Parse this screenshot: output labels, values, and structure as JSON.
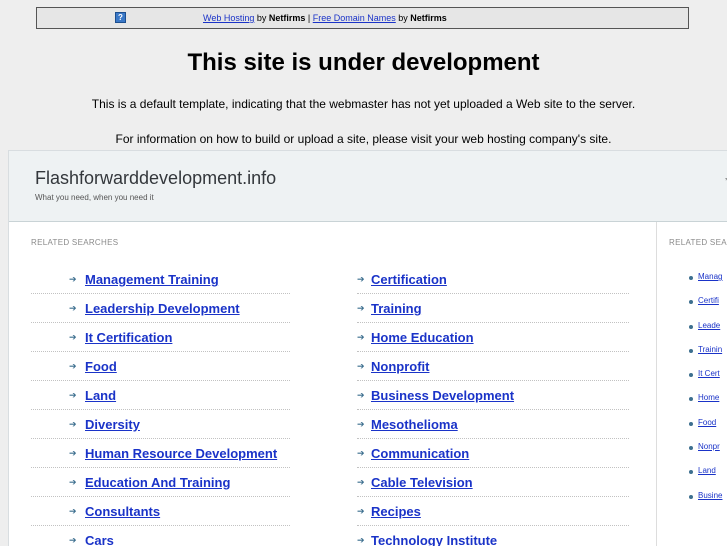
{
  "topbar": {
    "link1": "Web Hosting",
    "by1": " by ",
    "brand1": "Netfirms",
    "sep": " | ",
    "link2": "Free Domain Names",
    "by2": " by ",
    "brand2": "Netfirms"
  },
  "heading": "This site is under development",
  "info_line1": "This is a default template, indicating that the webmaster has not yet uploaded a Web site to the server.",
  "info_line2": "For information on how to build or upload a site, please visit your web hosting company's site.",
  "site": {
    "title": "Flashforwarddevelopment.info",
    "tagline": "What you need, when you need it",
    "head_right_glyph": "’"
  },
  "related_label": "RELATED SEARCHES",
  "side_label": "RELATED SEA",
  "list_left": [
    "Management Training",
    "Leadership Development",
    "It Certification",
    "Food",
    "Land",
    "Diversity",
    "Human Resource Development",
    "Education And Training",
    "Consultants",
    "Cars"
  ],
  "list_right": [
    "Certification",
    "Training",
    "Home Education",
    "Nonprofit",
    "Business Development",
    "Mesothelioma",
    "Communication",
    "Cable Television",
    "Recipes",
    "Technology Institute"
  ],
  "side_list": [
    "Manag",
    "Certifi",
    "Leade",
    "Trainin",
    "It Cert",
    "Home",
    "Food",
    "Nonpr",
    "Land",
    "Busine"
  ]
}
